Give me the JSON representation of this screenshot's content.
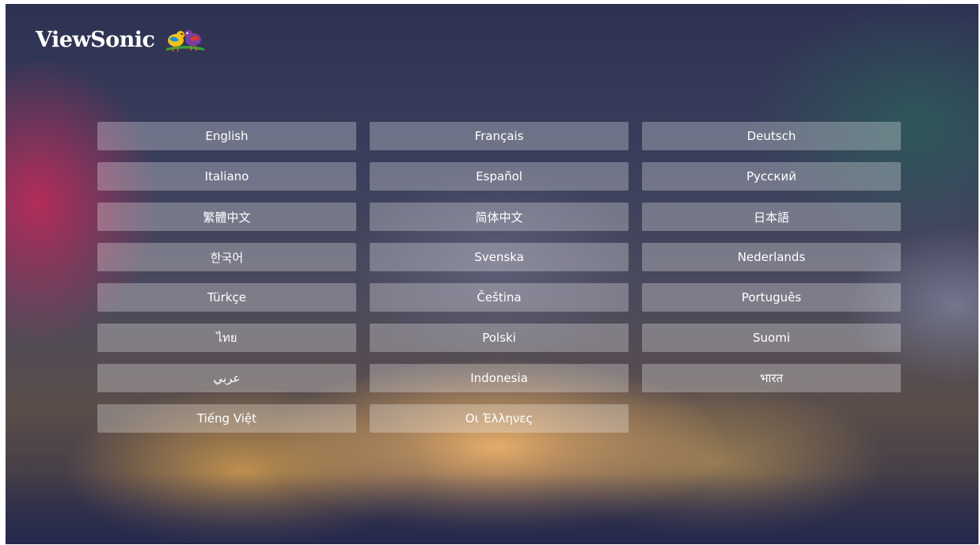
{
  "brand": {
    "name": "ViewSonic",
    "logo_icon": "viewsonic-birds-logo-icon"
  },
  "languages": [
    "English",
    "Français",
    "Deutsch",
    "Italiano",
    "Español",
    "Русский",
    "繁體中文",
    "简体中文",
    "日本語",
    "한국어",
    "Svenska",
    "Nederlands",
    "Türkçe",
    "Čeština",
    "Português",
    "ไทย",
    "Polski",
    "Suomi",
    "عربي",
    "Indonesia",
    "भारत",
    "Tiếng Việt",
    "Οι Έλληνες"
  ],
  "colors": {
    "button_bg": "rgba(255,255,255,0.28)",
    "text": "#ffffff"
  }
}
